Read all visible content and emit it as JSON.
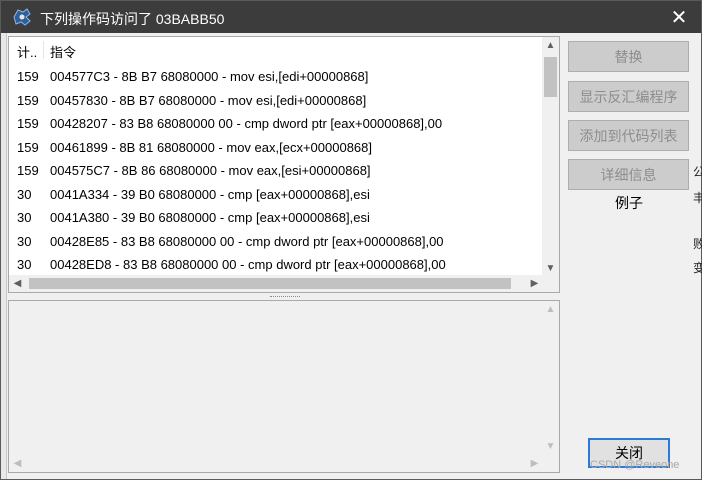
{
  "window": {
    "title": "下列操作码访问了 03BABB50",
    "close_glyph": "✕"
  },
  "list": {
    "columns": [
      "计..",
      "指令"
    ],
    "rows": [
      {
        "count": "159",
        "instruction": "004577C3 - 8B B7 68080000  - mov esi,[edi+00000868]"
      },
      {
        "count": "159",
        "instruction": "00457830 - 8B B7 68080000  - mov esi,[edi+00000868]"
      },
      {
        "count": "159",
        "instruction": "00428207 - 83 B8 68080000 00 - cmp dword ptr [eax+00000868],00"
      },
      {
        "count": "159",
        "instruction": "00461899 - 8B 81 68080000  - mov eax,[ecx+00000868]"
      },
      {
        "count": "159",
        "instruction": "004575C7 - 8B 86 68080000  - mov eax,[esi+00000868]"
      },
      {
        "count": "30",
        "instruction": "0041A334 - 39 B0 68080000  - cmp [eax+00000868],esi"
      },
      {
        "count": "30",
        "instruction": "0041A380 - 39 B0 68080000  - cmp [eax+00000868],esi"
      },
      {
        "count": "30",
        "instruction": "00428E85 - 83 B8 68080000 00 - cmp dword ptr [eax+00000868],00"
      },
      {
        "count": "30",
        "instruction": "00428ED8 - 83 B8 68080000 00 - cmp dword ptr [eax+00000868],00"
      }
    ]
  },
  "buttons": {
    "replace": "替换",
    "show_disassembler": "显示反汇编程序",
    "add_to_codelist": "添加到代码列表",
    "more_info": "详细信息",
    "close": "关闭"
  },
  "example_label": "例子",
  "background_peek": [
    "公",
    "丰",
    "败",
    "变"
  ],
  "watermark": "CSDN @Reveone",
  "icons": {
    "app": "cheat-engine-icon",
    "close": "close-icon",
    "scroll_up": "▲",
    "scroll_down": "▼",
    "scroll_left": "◀",
    "scroll_right": "▶"
  }
}
